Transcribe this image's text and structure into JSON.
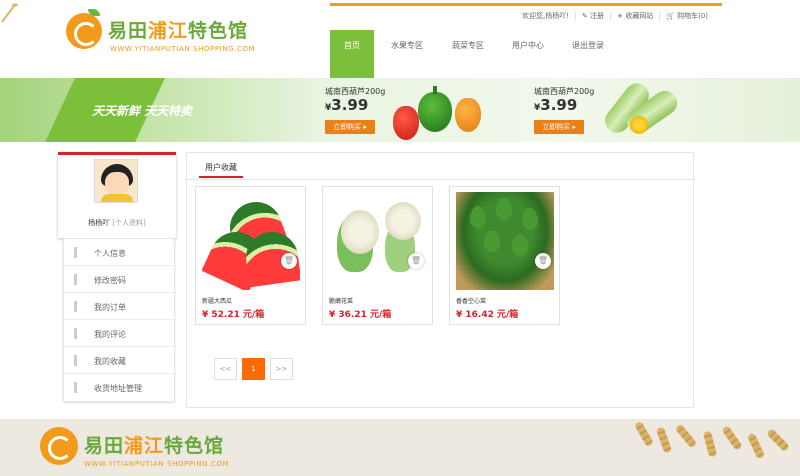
{
  "brand": {
    "name_part1": "易田",
    "name_part2": "浦江",
    "name_part3": "特色馆",
    "url": "WWW.YITIANPUTIAN SHOPPING.COM"
  },
  "toplinks": {
    "welcome": "欢迎您,杨杨吖!",
    "register": "注册",
    "favorites": "收藏网站",
    "cart": "购物车(0)"
  },
  "nav": [
    "首页",
    "水果专区",
    "蔬菜专区",
    "用户中心",
    "退出登录"
  ],
  "banner": {
    "slogan": "天天新鲜  天天特卖",
    "promos": [
      {
        "name": "城南西葫芦200g",
        "currency": "¥",
        "price": "3.99",
        "button": "立即购买 ▸"
      },
      {
        "name": "城南西葫芦200g",
        "currency": "¥",
        "price": "3.99",
        "button": "立即购买 ▸"
      }
    ]
  },
  "profile": {
    "username": "杨杨吖",
    "info_link": "[个人资料]"
  },
  "menu": [
    "个人信息",
    "修改密码",
    "我的订单",
    "我的评论",
    "我的收藏",
    "收货地址管理"
  ],
  "main": {
    "tab": "用户收藏",
    "products": [
      {
        "name": "新疆大西瓜",
        "price": "¥ 52.21 元/箱"
      },
      {
        "name": "脆嫩花菜",
        "price": "¥ 36.21 元/箱"
      },
      {
        "name": "香香空心菜",
        "price": "¥ 16.42 元/箱"
      }
    ]
  },
  "pagination": {
    "prev": "<<",
    "current": "1",
    "next": ">>"
  },
  "colors": {
    "brand_green": "#7cbf3a",
    "brand_orange": "#f29a1a",
    "accent_red": "#d6222a",
    "page_active": "#ff6a00"
  }
}
